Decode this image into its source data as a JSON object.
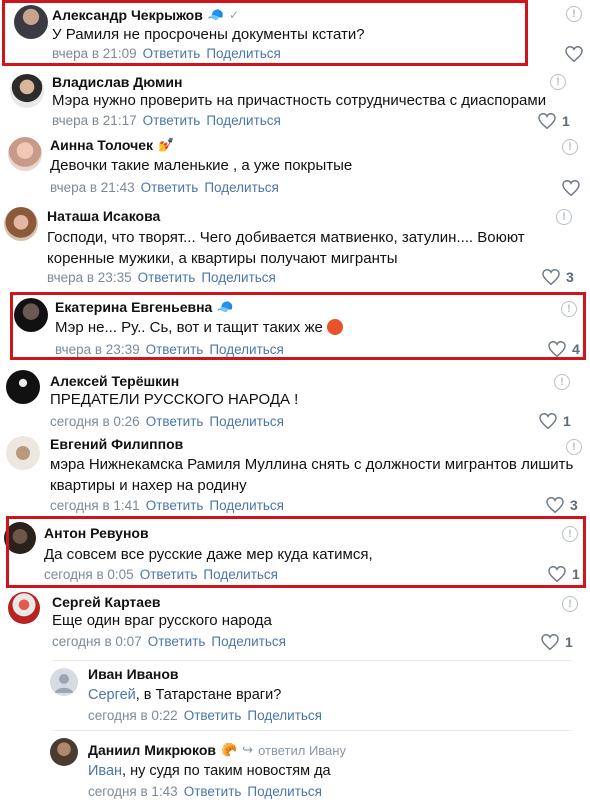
{
  "comments": [
    {
      "name": "Александр Чекрыжов",
      "badge": "🧢",
      "verified": "✓",
      "text": "У Рамиля не просрочены документы кстати?",
      "time": "вчера в 21:09",
      "reply": "Ответить",
      "share": "Поделиться",
      "likes": ""
    },
    {
      "name": "Владислав Дюмин",
      "text": "Мэра нужно проверить на причастность сотрудничества с диаспорами",
      "time": "вчера в 21:17",
      "reply": "Ответить",
      "share": "Поделиться",
      "likes": "1"
    },
    {
      "name": "Аинна Толочек",
      "badge": "💅",
      "text": "Девочки такие маленькие , а уже покрытые",
      "time": "вчера в 21:43",
      "reply": "Ответить",
      "share": "Поделиться",
      "likes": ""
    },
    {
      "name": "Наташа Исакова",
      "text_lines": [
        "Господи, что творят... Чего добивается матвиенко, затулин.... Воюют",
        "коренные мужики, а квартиры получают мигранты"
      ],
      "time": "вчера в 23:35",
      "reply": "Ответить",
      "share": "Поделиться",
      "likes": "3"
    },
    {
      "name": "Екатерина Евгеньевна",
      "badge": "🧢",
      "text": "Мэр не... Ру.. Сь, вот и тащит таких же",
      "time": "вчера в 23:39",
      "reply": "Ответить",
      "share": "Поделиться",
      "likes": "4"
    },
    {
      "name": "Алексей Терёшкин",
      "text": "ПРЕДАТЕЛИ РУССКОГО НАРОДА !",
      "time": "сегодня в 0:26",
      "reply": "Ответить",
      "share": "Поделиться",
      "likes": "1"
    },
    {
      "name": "Евгений Филиппов",
      "text_lines": [
        "мэра Нижнекамска Рамиля Муллина снять с должности мигрантов лишить",
        "квартиры и нахер на родину"
      ],
      "time": "сегодня в 1:41",
      "reply": "Ответить",
      "share": "Поделиться",
      "likes": "3"
    },
    {
      "name": "Антон Ревунов",
      "text": "Да совсем все русские даже мер куда катимся,",
      "time": "сегодня в 0:05",
      "reply": "Ответить",
      "share": "Поделиться",
      "likes": "1"
    },
    {
      "name": "Сергей Картаев",
      "text": "Еще один враг русского народа",
      "time": "сегодня в 0:07",
      "reply": "Ответить",
      "share": "Поделиться",
      "likes": "1"
    }
  ],
  "replies": [
    {
      "name": "Иван Иванов",
      "mention": "Сергей",
      "text": ", в Татарстане враги?",
      "time": "сегодня в 0:22",
      "reply": "Ответить",
      "share": "Поделиться"
    },
    {
      "name": "Даниил Микрюков",
      "badge": "🥐",
      "replied_to": "ответил Ивану",
      "mention": "Иван",
      "text": ", ну судя по таким новостям да",
      "time": "сегодня в 1:43",
      "reply": "Ответить",
      "share": "Поделиться"
    }
  ]
}
